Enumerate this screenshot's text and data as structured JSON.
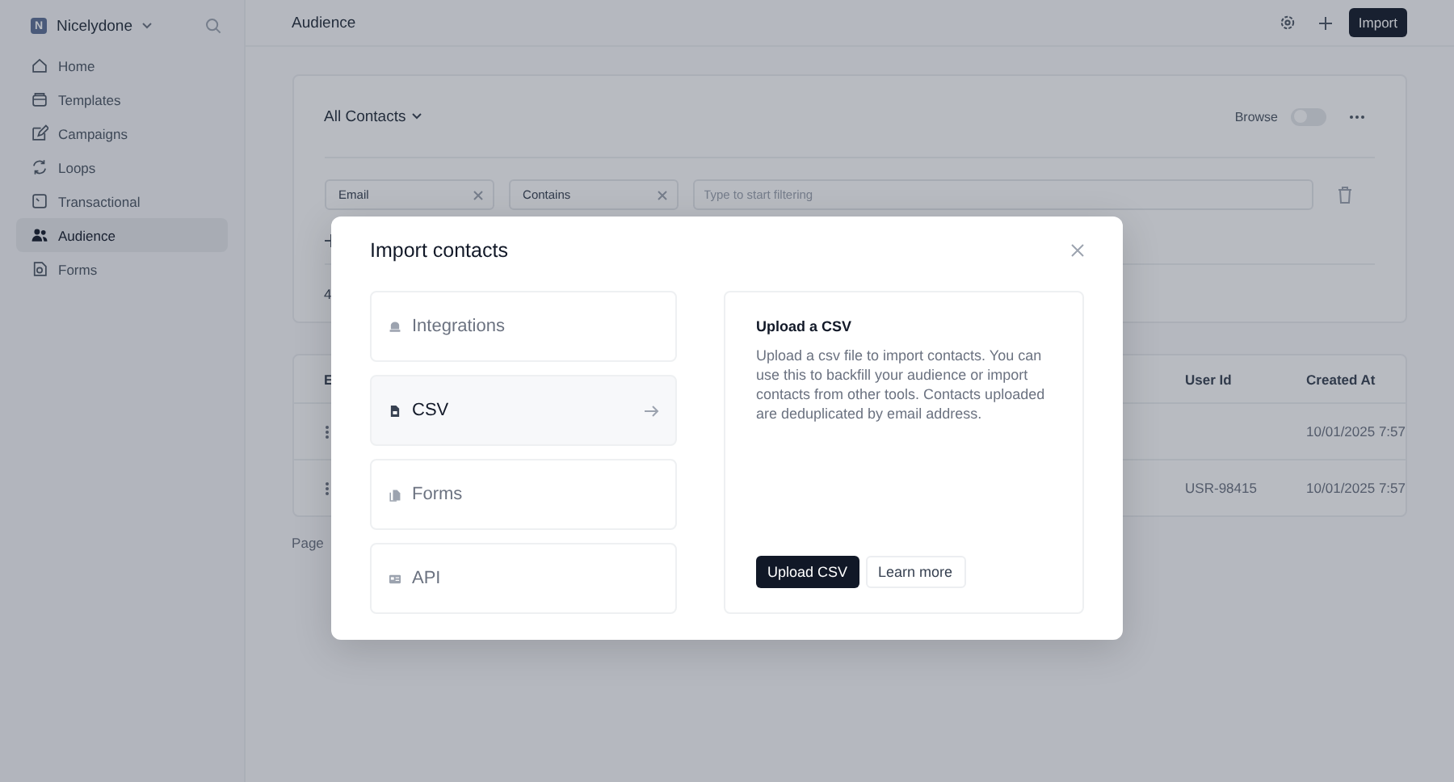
{
  "sidebar": {
    "workspace": {
      "initial": "N",
      "name": "Nicelydone"
    },
    "items": [
      {
        "label": "Home",
        "selected": false
      },
      {
        "label": "Templates",
        "selected": false
      },
      {
        "label": "Campaigns",
        "selected": false
      },
      {
        "label": "Loops",
        "selected": false
      },
      {
        "label": "Transactional",
        "selected": false
      },
      {
        "label": "Audience",
        "selected": true
      },
      {
        "label": "Forms",
        "selected": false
      }
    ]
  },
  "header": {
    "title": "Audience",
    "action": "Import"
  },
  "contacts_panel": {
    "view": "All Contacts",
    "browse_label": "Browse",
    "browse_on": false,
    "filters": [
      {
        "value": "Email"
      },
      {
        "value": "Contains"
      }
    ],
    "filter_placeholder": "Type to start filtering",
    "count_fragment": "4"
  },
  "table": {
    "columns": [
      "E",
      "User Id",
      "Created At"
    ],
    "rows": [
      {
        "created_at": "10/01/2025 7:57"
      },
      {
        "user_id": "USR-98415",
        "created_at": "10/01/2025 7:57"
      }
    ]
  },
  "pagination": "Page",
  "modal": {
    "title": "Import contacts",
    "options": [
      {
        "label": "Integrations",
        "selected": false
      },
      {
        "label": "CSV",
        "selected": true
      },
      {
        "label": "Forms",
        "selected": false
      },
      {
        "label": "API",
        "selected": false
      }
    ],
    "detail": {
      "title": "Upload a CSV",
      "body": "Upload a csv file to import contacts. You can use this to backfill your audience or import contacts from other tools. Contacts uploaded are deduplicated by email address.",
      "primary": "Upload CSV",
      "secondary": "Learn more"
    }
  }
}
